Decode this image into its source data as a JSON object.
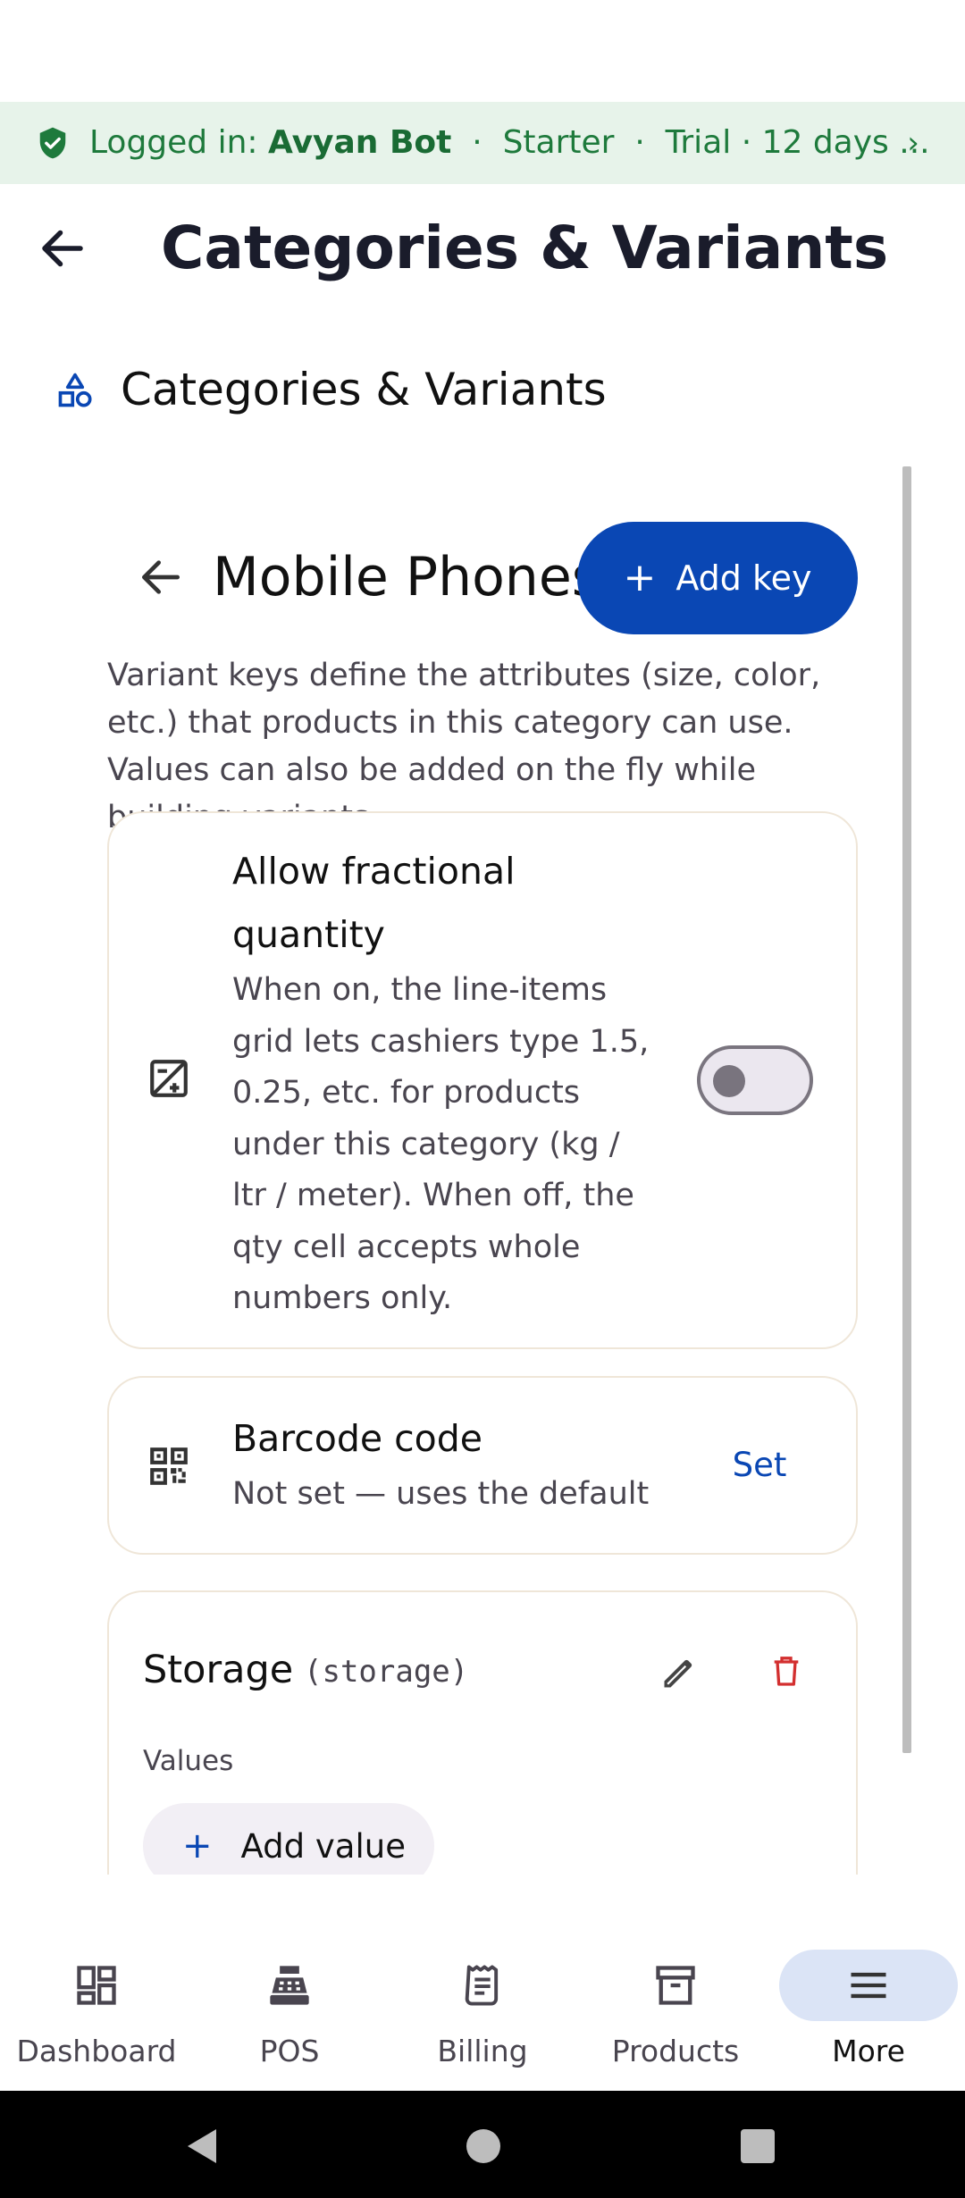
{
  "banner": {
    "prefix": "Logged in: ",
    "user": "Avyan Bot",
    "rest": "  ·  Starter  ·  Trial · 12 days ...",
    "icon": "shield-check-icon",
    "accent": "#1e7a3c",
    "background": "#e7f3ea"
  },
  "topbar": {
    "title": "Categories & Variants",
    "back_icon": "arrow-left-icon"
  },
  "section": {
    "title": "Categories & Variants",
    "icon": "category-shapes-icon"
  },
  "category": {
    "name": "Mobile Phones",
    "add_key_label": "Add key",
    "description": "Variant keys define the attributes (size, color, etc.) that products in this category can use. Values can also be added on the fly while building variants."
  },
  "fractional": {
    "title": "Allow fractional quantity",
    "description": "When on, the line-items grid lets cashiers type 1.5, 0.25, etc. for products under this category (kg / ltr / meter). When off, the qty cell accepts whole numbers only.",
    "enabled": false,
    "icon": "decimal-square-icon"
  },
  "barcode": {
    "title": "Barcode code",
    "subtitle": "Not set — uses the default",
    "action_label": "Set",
    "icon": "qr-code-icon"
  },
  "variant_key": {
    "name": "Storage",
    "key": "(storage)",
    "values_label": "Values",
    "add_value_label": "Add value",
    "edit_icon": "pencil-icon",
    "delete_icon": "trash-icon"
  },
  "nav": {
    "items": [
      {
        "label": "Dashboard",
        "icon": "dashboard-icon",
        "active": false
      },
      {
        "label": "POS",
        "icon": "register-icon",
        "active": false
      },
      {
        "label": "Billing",
        "icon": "receipt-icon",
        "active": false
      },
      {
        "label": "Products",
        "icon": "archive-box-icon",
        "active": false
      },
      {
        "label": "More",
        "icon": "menu-icon",
        "active": true
      }
    ]
  },
  "colors": {
    "primary": "#0a47b4",
    "danger": "#d32f2f",
    "card_border": "#efe6d8",
    "active_nav": "#dbe4f6"
  }
}
